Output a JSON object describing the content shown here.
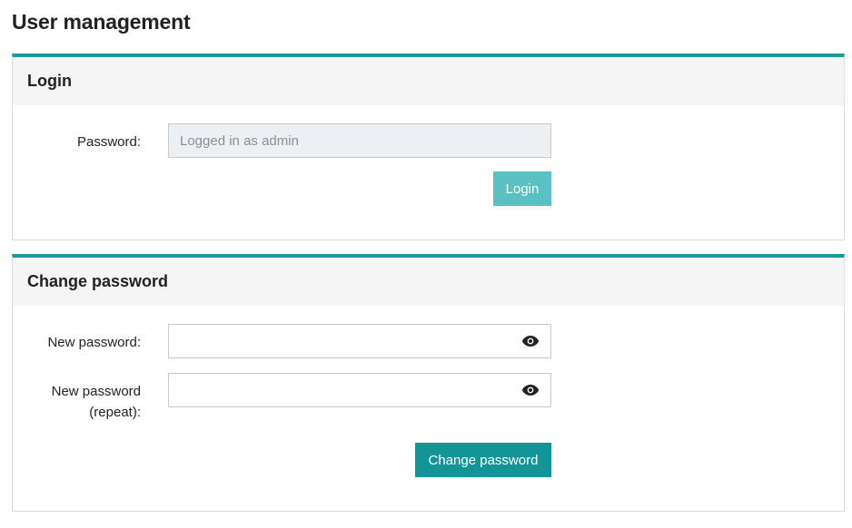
{
  "page": {
    "title": "User management"
  },
  "login_panel": {
    "title": "Login",
    "password_label": "Password:",
    "password_value": "Logged in as admin",
    "login_button": "Login"
  },
  "change_panel": {
    "title": "Change password",
    "new_password_label": "New password:",
    "repeat_label_line1": "New password",
    "repeat_label_line2": "(repeat):",
    "new_password_value": "",
    "repeat_value": "",
    "toggle_icon": "eye-icon",
    "change_button": "Change password"
  },
  "colors": {
    "accent": "#1a9a9c",
    "login_button": "#5bc0c2",
    "change_button": "#139496",
    "header_bg": "#f5f5f5",
    "disabled_input_bg": "#edf0f2"
  }
}
